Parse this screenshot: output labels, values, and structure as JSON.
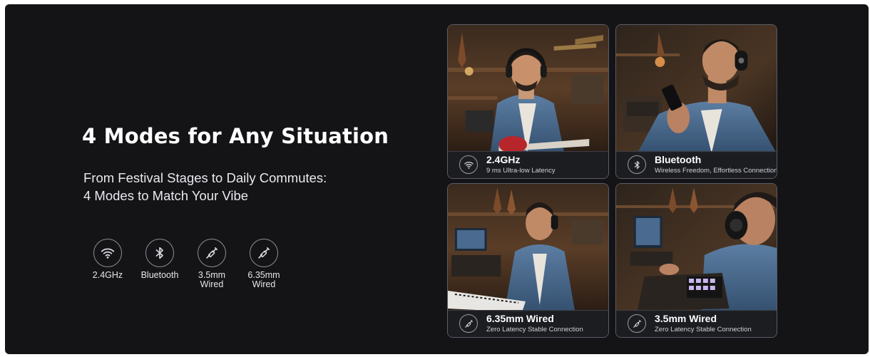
{
  "headline": "4 Modes for Any Situation",
  "subline": {
    "line1": "From Festival Stages to Daily Commutes:",
    "line2": "4 Modes to Match Your Vibe"
  },
  "modes": [
    {
      "icon": "wifi-icon",
      "label": "2.4GHz"
    },
    {
      "icon": "bluetooth-icon",
      "label": "Bluetooth"
    },
    {
      "icon": "audio-jack-icon",
      "label_line1": "3.5mm",
      "label_line2": "Wired"
    },
    {
      "icon": "audio-jack-icon",
      "label_line1": "6.35mm",
      "label_line2": "Wired"
    }
  ],
  "cards": [
    {
      "icon": "wifi-icon",
      "title": "2.4GHz",
      "desc": "9 ms Ultra-low Latency"
    },
    {
      "icon": "bluetooth-icon",
      "title": "Bluetooth",
      "desc": "Wireless Freedom, Effortless Connection"
    },
    {
      "icon": "audio-jack-icon",
      "title": "6.35mm Wired",
      "desc": "Zero Latency Stable Connection"
    },
    {
      "icon": "audio-jack-icon",
      "title": "3.5mm Wired",
      "desc": "Zero Latency Stable Connection"
    }
  ],
  "colors": {
    "background": "#141417",
    "text": "#ffffff",
    "icon_stroke": "#8d8e98",
    "caption_bg": "#1c1d22"
  }
}
